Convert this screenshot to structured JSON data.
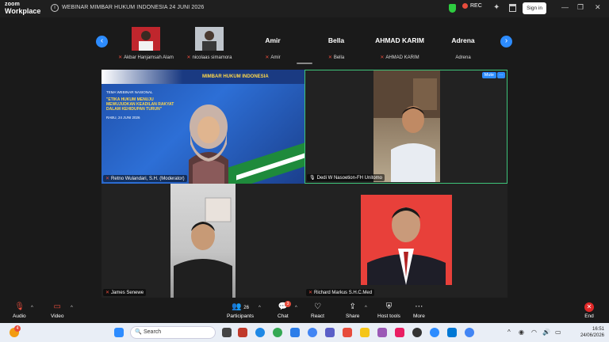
{
  "app": {
    "logo_line1": "zoom",
    "logo_line2": "Workplace",
    "meeting_title": "WEBINAR MIMBAR HUKUM INDONESIA 24 JUNI 2026",
    "rec_label": "REC",
    "signin_label": "Sign in"
  },
  "strip": {
    "participants": [
      {
        "name": "Akbar Hanjamsah Alam",
        "muted": true,
        "has_video": true
      },
      {
        "name": "nicolaas simamora",
        "muted": true,
        "has_video": true
      },
      {
        "name": "Amir",
        "display": "Amir",
        "muted": true,
        "has_video": false
      },
      {
        "name": "Bella",
        "display": "Bella",
        "muted": true,
        "has_video": false
      },
      {
        "name": "AHMAD KARIM",
        "display": "AHMAD KARIM",
        "muted": true,
        "has_video": false
      },
      {
        "name": "Adrena",
        "display": "Adrena",
        "muted": false,
        "has_video": false
      }
    ]
  },
  "tiles": {
    "t1": {
      "name": "Retno Wulandari, S.H. (Moderator)",
      "banner": "MIMBAR HUKUM INDONESIA",
      "slide_theme": "TEMA WEBINAR NASIONAL",
      "slide_topic": "\"ETIKA HUKUM MENUJU MEWUJUDKAN KEADILAN RAKYAT DALAM KEHIDUPAN TURUN\"",
      "slide_date": "RABU, 24 JUNI 2026"
    },
    "t2": {
      "name": "Dedi W Nasoetion-FH Unitomo",
      "mute_label": "Mute",
      "more_label": "···"
    },
    "t3": {
      "name": "James Senewe"
    },
    "t4": {
      "name": "Richard Markus S.H.C.Med"
    }
  },
  "toolbar": {
    "audio": "Audio",
    "video": "Video",
    "participants": "Participants",
    "participants_count": "26",
    "chat": "Chat",
    "chat_badge": "3",
    "react": "React",
    "share": "Share",
    "host_tools": "Host tools",
    "more": "More",
    "end": "End"
  },
  "taskbar": {
    "search_placeholder": "Search",
    "time": "16:51",
    "date": "24/06/2026",
    "notif_badge": "4"
  },
  "colors": {
    "accent": "#2d8cff",
    "active_border": "#3ec47a",
    "end_red": "#e02828"
  }
}
